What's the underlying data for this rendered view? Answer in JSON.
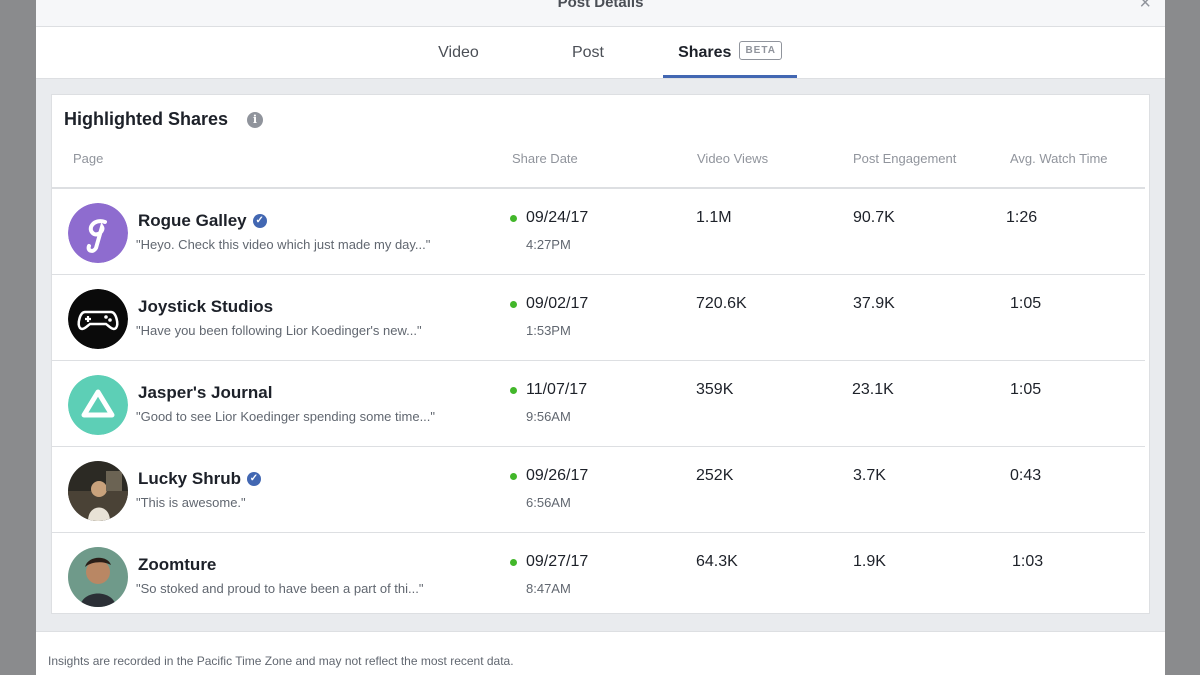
{
  "modal": {
    "title": "Post Details"
  },
  "tabs": [
    {
      "label": "Video"
    },
    {
      "label": "Post"
    },
    {
      "label": "Shares",
      "badge": "BETA"
    }
  ],
  "card": {
    "title": "Highlighted Shares",
    "columns": [
      "Page",
      "Share Date",
      "Video Views",
      "Post Engagement",
      "Avg. Watch Time"
    ]
  },
  "rows": [
    {
      "page": "Rogue Galley",
      "verified": true,
      "quote": "\"Heyo. Check this video which just made my day...\"",
      "date": "09/24/17",
      "time": "4:27PM",
      "views": "1.1M",
      "engagement": "90.7K",
      "watch": "1:26",
      "avatar": "purple-g-logo"
    },
    {
      "page": "Joystick Studios",
      "verified": false,
      "quote": "\"Have you been following Lior Koedinger's new...\"",
      "date": "09/02/17",
      "time": "1:53PM",
      "views": "720.6K",
      "engagement": "37.9K",
      "watch": "1:05",
      "avatar": "gamepad-logo"
    },
    {
      "page": "Jasper's Journal",
      "verified": false,
      "quote": "\"Good to see Lior Koedinger spending some time...\"",
      "date": "11/07/17",
      "time": "9:56AM",
      "views": "359K",
      "engagement": "23.1K",
      "watch": "1:05",
      "avatar": "triangle-logo"
    },
    {
      "page": "Lucky Shrub",
      "verified": true,
      "quote": "\"This is awesome.\"",
      "date": "09/26/17",
      "time": "6:56AM",
      "views": "252K",
      "engagement": "3.7K",
      "watch": "0:43",
      "avatar": "person-photo"
    },
    {
      "page": "Zoomture",
      "verified": false,
      "quote": "\"So stoked and proud to have been a part of thi...\"",
      "date": "09/27/17",
      "time": "8:47AM",
      "views": "64.3K",
      "engagement": "1.9K",
      "watch": "1:03",
      "avatar": "person-photo"
    }
  ],
  "footer": {
    "note": "Insights are recorded in the Pacific Time Zone and may not reflect the most recent data."
  },
  "colors": {
    "accent": "#4267b2",
    "status_green": "#42b72a",
    "avatar_purple": "#8e6ccf",
    "avatar_teal": "#5dcfb6"
  }
}
